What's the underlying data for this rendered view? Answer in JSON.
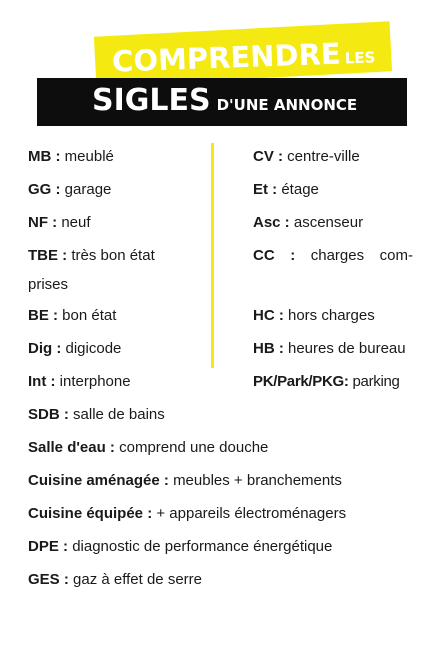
{
  "header": {
    "line1_big": "COMPRENDRE",
    "line1_small": "LES",
    "line2_big": "SIGLES",
    "line2_small": "D'UNE ANNONCE"
  },
  "left_column": [
    {
      "abbr": "MB :",
      "def": "meublé"
    },
    {
      "abbr": "GG :",
      "def": "garage"
    },
    {
      "abbr": "NF :",
      "def": "neuf"
    },
    {
      "abbr": "TBE :",
      "def": "très bon état",
      "def_cont": "prises"
    },
    {
      "abbr": "BE :",
      "def": "bon état"
    },
    {
      "abbr": "Dig :",
      "def": "digicode"
    },
    {
      "abbr": "Int :",
      "def": "interphone"
    },
    {
      "abbr": "SDB :",
      "def": "salle de bains"
    }
  ],
  "right_column": [
    {
      "abbr": "CV :",
      "def": "centre-ville"
    },
    {
      "abbr": "Et :",
      "def": "étage"
    },
    {
      "abbr": "Asc :",
      "def": "ascenseur"
    },
    {
      "abbr": "CC",
      "sep": ":",
      "def": "charges",
      "def_end": "com-"
    },
    {
      "abbr": "HC :",
      "def": "hors charges"
    },
    {
      "abbr": "HB :",
      "def": "heures de bureau"
    },
    {
      "abbr": "PK/Park/PKG:",
      "def": "parking"
    }
  ],
  "full_width": [
    {
      "abbr": "Salle d'eau :",
      "def": "comprend une douche"
    },
    {
      "abbr": "Cuisine aménagée :",
      "def": "meubles + branchements"
    },
    {
      "abbr": "Cuisine équipée :",
      "def": "+ appareils électroménagers"
    },
    {
      "abbr": "DPE :",
      "def": "diagnostic de performance énergétique"
    },
    {
      "abbr": "GES :",
      "def": "gaz à effet de serre"
    }
  ],
  "colors": {
    "accent_yellow": "#f4ea12",
    "banner_black": "#0d0d0d"
  }
}
